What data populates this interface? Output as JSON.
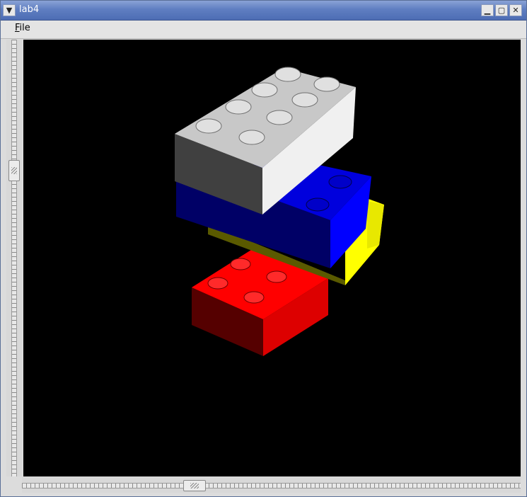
{
  "window": {
    "title": "lab4",
    "menu_icon": "chevron-down-icon",
    "buttons": [
      {
        "name": "minimize-button",
        "glyph": "▁"
      },
      {
        "name": "maximize-button",
        "glyph": "▢"
      },
      {
        "name": "close-button",
        "glyph": "✕"
      }
    ]
  },
  "menubar": {
    "items": [
      {
        "label": "File",
        "mnemonic": "F"
      }
    ]
  },
  "viewport": {
    "background": "#000000",
    "scene": "lego-bricks-3d",
    "bricks": [
      {
        "name": "white-brick",
        "color": "#ffffff",
        "studs": 8
      },
      {
        "name": "blue-brick",
        "color": "#0000ff",
        "studs": 4
      },
      {
        "name": "yellow-brick",
        "color": "#ffff00",
        "studs": 0
      },
      {
        "name": "red-brick",
        "color": "#ff0000",
        "studs": 4
      }
    ]
  },
  "scrollbars": {
    "vertical": {
      "position": 0.25
    },
    "horizontal": {
      "position": 0.35
    }
  }
}
